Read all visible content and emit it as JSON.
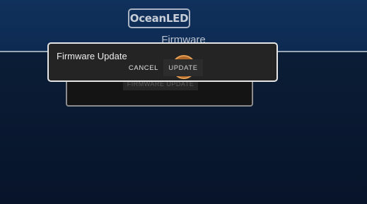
{
  "header": {
    "logo_text": "OceanLED",
    "page_title": "Firmware"
  },
  "firmware_card": {
    "button_label": "FIRMWARE UPDATE"
  },
  "dialog": {
    "title": "Firmware Update",
    "cancel_label": "CANCEL",
    "update_label": "UPDATE"
  },
  "colors": {
    "header_bg": "#0d2a52",
    "content_bg": "#07142a",
    "dialog_bg": "#242424",
    "touch_ripple": "#d67a2c"
  }
}
